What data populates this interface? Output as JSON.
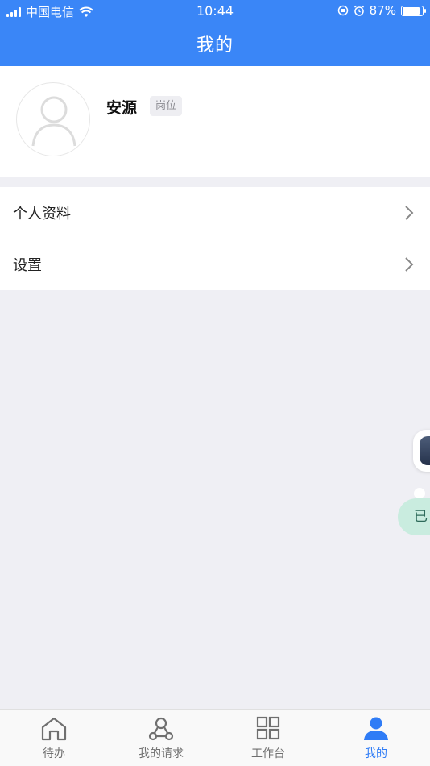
{
  "status_bar": {
    "carrier": "中国电信",
    "time": "10:44",
    "battery_percent": "87%",
    "battery_level": 0.87
  },
  "nav": {
    "title": "我的"
  },
  "profile": {
    "name": "安源",
    "role_badge": "岗位"
  },
  "menu": {
    "items": [
      {
        "label": "个人资料"
      },
      {
        "label": "设置"
      }
    ]
  },
  "floating": {
    "pill_text": "已"
  },
  "tabbar": {
    "items": [
      {
        "label": "待办",
        "icon": "home-icon"
      },
      {
        "label": "我的请求",
        "icon": "network-icon"
      },
      {
        "label": "工作台",
        "icon": "grid-icon"
      },
      {
        "label": "我的",
        "icon": "person-icon"
      }
    ],
    "active_index": 3
  },
  "colors": {
    "brand_blue": "#3a86f7",
    "tab_active": "#2f7cf6",
    "tab_inactive": "#6f6f6f",
    "background": "#efeff4"
  }
}
